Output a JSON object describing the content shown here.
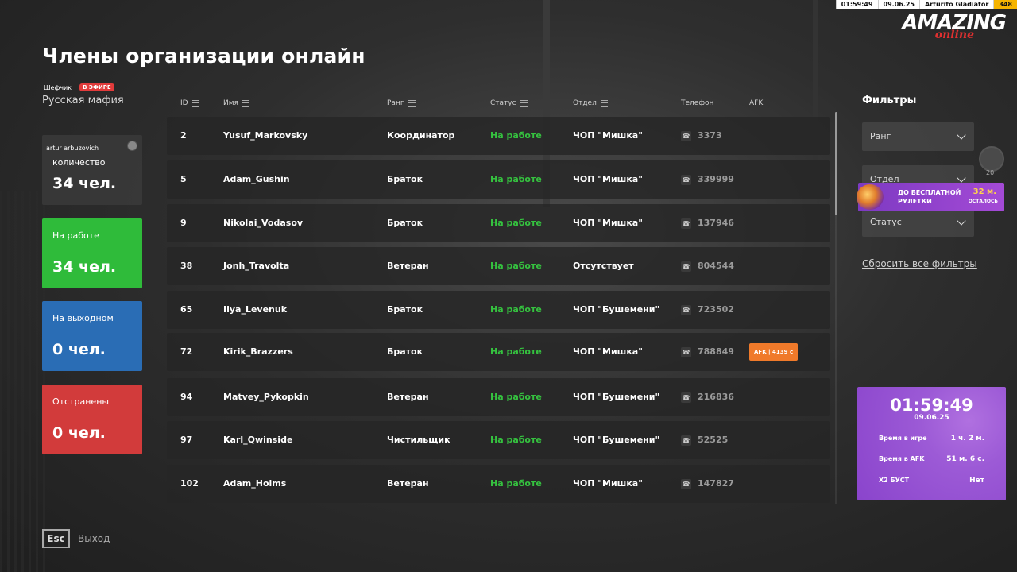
{
  "hud": {
    "time": "01:59:49",
    "date": "09.06.25",
    "player": "Arturito Gladiator",
    "counter": "348"
  },
  "logo": {
    "main": "AMAZING",
    "sub": "online"
  },
  "title": "Члены организации онлайн",
  "org": {
    "leader": "Шефчик",
    "live_badge": "В ЭФИРЕ",
    "name": "Русская мафия"
  },
  "chat_name": "artur arbuzovich",
  "stats": {
    "total": {
      "label": "количество",
      "value": "34 чел."
    },
    "working": {
      "label": "На работе",
      "value": "34 чел."
    },
    "off": {
      "label": "На выходном",
      "value": "0 чел."
    },
    "suspended": {
      "label": "Отстранены",
      "value": "0 чел."
    }
  },
  "table": {
    "headers": {
      "id": "ID",
      "name": "Имя",
      "rank": "Ранг",
      "status": "Статус",
      "dept": "Отдел",
      "phone": "Телефон",
      "afk": "AFK"
    },
    "rows": [
      {
        "id": "2",
        "name": "Yusuf_Markovsky",
        "rank": "Координатор",
        "status": "На работе",
        "dept": "ЧОП \"Мишка\"",
        "phone": "3373",
        "afk": ""
      },
      {
        "id": "5",
        "name": "Adam_Gushin",
        "rank": "Браток",
        "status": "На работе",
        "dept": "ЧОП \"Мишка\"",
        "phone": "339999",
        "afk": ""
      },
      {
        "id": "9",
        "name": "Nikolai_Vodasov",
        "rank": "Браток",
        "status": "На работе",
        "dept": "ЧОП \"Мишка\"",
        "phone": "137946",
        "afk": ""
      },
      {
        "id": "38",
        "name": "Jonh_Travolta",
        "rank": "Ветеран",
        "status": "На работе",
        "dept": "Отсутствует",
        "phone": "804544",
        "afk": ""
      },
      {
        "id": "65",
        "name": "Ilya_Levenuk",
        "rank": "Браток",
        "status": "На работе",
        "dept": "ЧОП \"Бушемени\"",
        "phone": "723502",
        "afk": ""
      },
      {
        "id": "72",
        "name": "Kirik_Brazzers",
        "rank": "Браток",
        "status": "На работе",
        "dept": "ЧОП \"Мишка\"",
        "phone": "788849",
        "afk": "AFK  |  4139 с"
      },
      {
        "id": "94",
        "name": "Matvey_Pykopkin",
        "rank": "Ветеран",
        "status": "На работе",
        "dept": "ЧОП \"Бушемени\"",
        "phone": "216836",
        "afk": ""
      },
      {
        "id": "97",
        "name": "Karl_Qwinside",
        "rank": "Чистильщик",
        "status": "На работе",
        "dept": "ЧОП \"Бушемени\"",
        "phone": "52525",
        "afk": ""
      },
      {
        "id": "102",
        "name": "Adam_Holms",
        "rank": "Ветеран",
        "status": "На работе",
        "dept": "ЧОП \"Мишка\"",
        "phone": "147827",
        "afk": ""
      }
    ]
  },
  "filters": {
    "title": "Фильтры",
    "rank": "Ранг",
    "dept": "Отдел",
    "status": "Статус",
    "reset": "Сбросить все фильтры"
  },
  "promo": {
    "text_line1": "ДО БЕСПЛАТНОЙ",
    "text_line2": "РУЛЕТКИ",
    "minutes": "32 м.",
    "suffix": "ОСТАЛОСЬ"
  },
  "coin_label": "20",
  "timecard": {
    "clock": "01:59:49",
    "date": "09.06.25",
    "rows": [
      {
        "label": "Время в игре",
        "value": "1 ч. 2 м."
      },
      {
        "label": "Время в AFK",
        "value": "51 м. 6 с."
      },
      {
        "label": "X2 БУСТ",
        "value": "Нет"
      }
    ]
  },
  "esc": {
    "key": "Esc",
    "label": "Выход"
  },
  "colors": {
    "status_green": "#35c23f",
    "working_card": "#2fbb3a",
    "off_card": "#2a6db5",
    "suspended_card": "#d23b3b",
    "afk_badge": "#f07a2a",
    "timecard": "#9c5ad6"
  }
}
